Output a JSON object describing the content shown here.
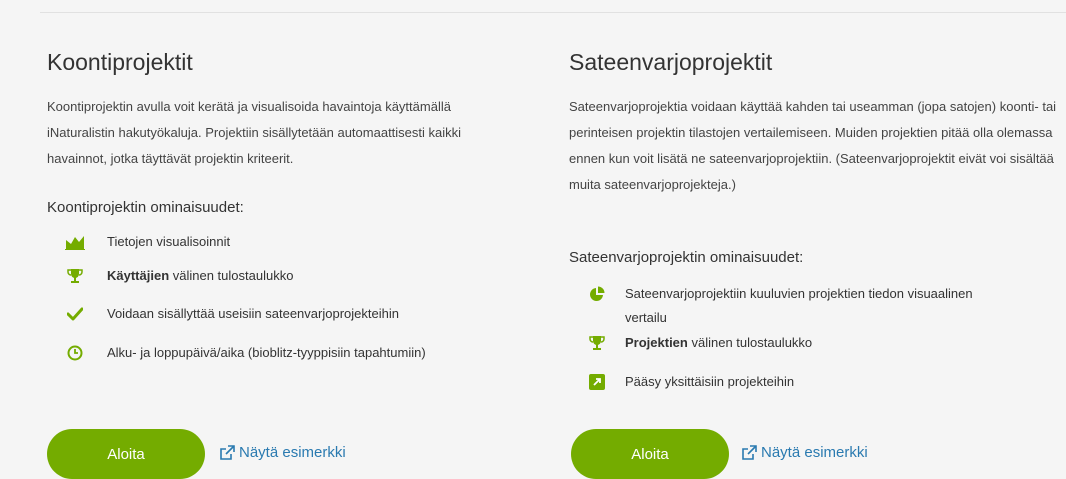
{
  "left": {
    "title": "Koontiprojektit",
    "description": "Koontiprojektin avulla voit kerätä ja visualisoida havaintoja käyttämällä iNaturalistin hakutyökaluja. Projektiin sisällytetään automaattisesti kaikki havainnot, jotka täyttävät projektin kriteerit.",
    "features_title": "Koontiprojektin ominaisuudet:",
    "features": [
      {
        "icon": "chart-area-icon",
        "text": "Tietojen visualisoinnit",
        "strong": ""
      },
      {
        "icon": "trophy-icon",
        "strong": "Käyttäjien",
        "text": " välinen tulostaulukko"
      },
      {
        "icon": "check-icon",
        "text": "Voidaan sisällyttää useisiin sateenvarjoprojekteihin",
        "strong": ""
      },
      {
        "icon": "clock-icon",
        "text": "Alku- ja loppupäivä/aika (bioblitz-tyyppisiin tapahtumiin)",
        "strong": ""
      }
    ],
    "button_label": "Aloita",
    "link_label": "Näytä esimerkki"
  },
  "right": {
    "title": "Sateenvarjoprojektit",
    "description": "Sateenvarjoprojektia voidaan käyttää kahden tai useamman (jopa satojen) koonti- tai perinteisen projektin tilastojen vertailemiseen. Muiden projektien pitää olla olemassa ennen kun voit lisätä ne sateenvarjoprojektiin. (Sateenvarjoprojektit eivät voi sisältää muita sateenvarjoprojekteja.)",
    "features_title": "Sateenvarjoprojektin ominaisuudet:",
    "features": [
      {
        "icon": "pie-chart-icon",
        "text": "Sateenvarjoprojektiin kuuluvien projektien tiedon visuaalinen vertailu",
        "strong": ""
      },
      {
        "icon": "trophy-icon",
        "strong": "Projektien",
        "text": " välinen tulostaulukko"
      },
      {
        "icon": "external-square-icon",
        "text": "Pääsy yksittäisiin projekteihin",
        "strong": ""
      }
    ],
    "button_label": "Aloita",
    "link_label": "Näytä esimerkki"
  },
  "colors": {
    "accent": "#74ac00",
    "link": "#2a7ab0",
    "background": "#f5f5f5"
  }
}
